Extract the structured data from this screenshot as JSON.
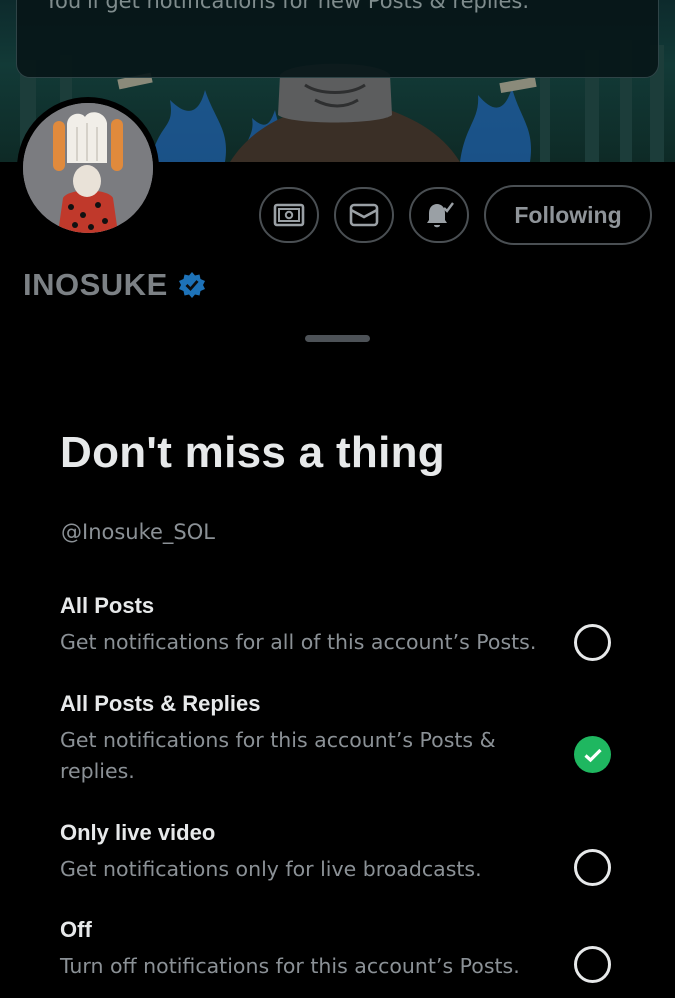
{
  "banner": {
    "toast_text": "You'll get notifications for new Posts & replies."
  },
  "profile": {
    "display_name": "INOSUKE",
    "verified": true,
    "follow_label": "Following",
    "icons": [
      "tip-jar-icon",
      "mail-icon",
      "bell-check-icon"
    ]
  },
  "sheet": {
    "title": "Don't miss a thing",
    "handle": "@Inosuke_SOL",
    "options": [
      {
        "title": "All Posts",
        "desc": "Get notifications for all of this account’s Posts.",
        "selected": false
      },
      {
        "title": "All Posts & Replies",
        "desc": "Get notifications for this account’s Posts & replies.",
        "selected": true
      },
      {
        "title": "Only live video",
        "desc": "Get notifications only for live broadcasts.",
        "selected": false
      },
      {
        "title": "Off",
        "desc": "Turn off notifications for this account’s Posts.",
        "selected": false
      }
    ]
  },
  "colors": {
    "background": "#000000",
    "accent_check": "#1fb760",
    "verified_badge": "#1d9bf0",
    "muted_text": "#8b9196"
  }
}
